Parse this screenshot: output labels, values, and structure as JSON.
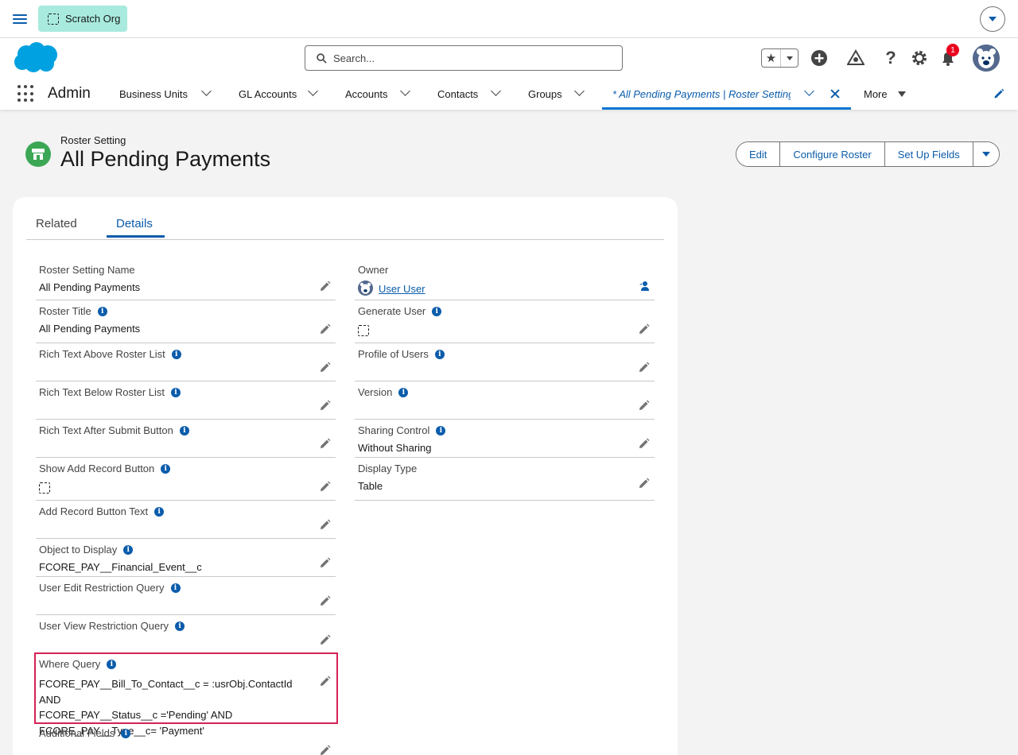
{
  "util_bar": {
    "org_label": "Scratch Org"
  },
  "header": {
    "search_placeholder": "Search...",
    "notification_count": "1"
  },
  "nav": {
    "app_name": "Admin",
    "items": [
      {
        "label": "Business Units"
      },
      {
        "label": "GL Accounts"
      },
      {
        "label": "Accounts"
      },
      {
        "label": "Contacts"
      },
      {
        "label": "Groups"
      }
    ],
    "active_tab": "* All Pending Payments | Roster Setting",
    "more_label": "More"
  },
  "record": {
    "object_type": "Roster Setting",
    "title": "All Pending Payments",
    "actions": [
      "Edit",
      "Configure Roster",
      "Set Up Fields"
    ]
  },
  "tabs": {
    "related": "Related",
    "details": "Details"
  },
  "fields_left": {
    "roster_setting_name": {
      "label": "Roster Setting Name",
      "value": "All Pending Payments"
    },
    "roster_title": {
      "label": "Roster Title",
      "value": "All Pending Payments"
    },
    "rich_above": {
      "label": "Rich Text Above Roster List",
      "value": ""
    },
    "rich_below": {
      "label": "Rich Text Below Roster List",
      "value": ""
    },
    "rich_after": {
      "label": "Rich Text After Submit Button",
      "value": ""
    },
    "show_add": {
      "label": "Show Add Record Button",
      "value": ""
    },
    "add_text": {
      "label": "Add Record Button Text",
      "value": ""
    },
    "object_display": {
      "label": "Object to Display",
      "value": "FCORE_PAY__Financial_Event__c"
    },
    "edit_restriction": {
      "label": "User Edit Restriction Query",
      "value": ""
    },
    "view_restriction": {
      "label": "User View Restriction Query",
      "value": ""
    },
    "where_query": {
      "label": "Where Query",
      "line1": "FCORE_PAY__Bill_To_Contact__c = :usrObj.ContactId AND",
      "line2": "FCORE_PAY__Status__c ='Pending' AND",
      "line3": "FCORE_PAY__Type__c= 'Payment'"
    },
    "additional_fields": {
      "label": "Additional Fields",
      "value": ""
    }
  },
  "fields_right": {
    "owner": {
      "label": "Owner",
      "value": "User User"
    },
    "generate_user": {
      "label": "Generate User",
      "value": ""
    },
    "profile_users": {
      "label": "Profile of Users",
      "value": ""
    },
    "version": {
      "label": "Version",
      "value": ""
    },
    "sharing_control": {
      "label": "Sharing Control",
      "value": "Without Sharing"
    },
    "display_type": {
      "label": "Display Type",
      "value": "Table"
    }
  },
  "colors": {
    "brand_blue": "#0b5cab",
    "accent_blue": "#0176d3",
    "highlight_border": "#d42254",
    "record_icon_green": "#3ba755",
    "scratch_org_bg": "#a8ebde"
  }
}
